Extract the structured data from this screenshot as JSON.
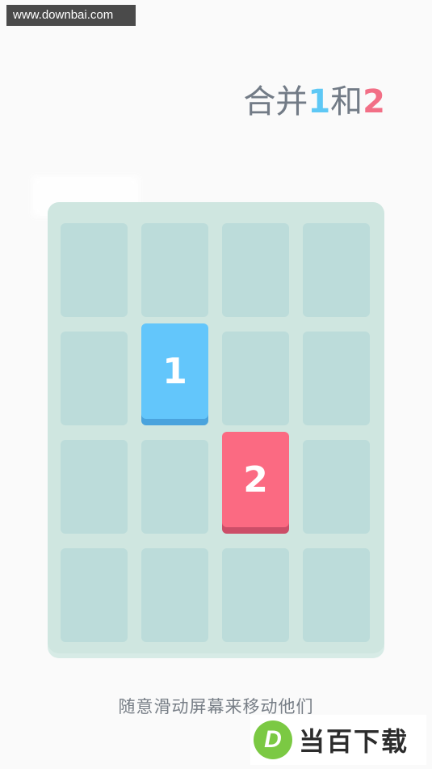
{
  "watermark_top": "www.downbai.com",
  "title": {
    "prefix": "合并",
    "num1": "1",
    "mid": "和",
    "num2": "2"
  },
  "board": {
    "rows": 4,
    "cols": 4,
    "tiles": [
      {
        "value": "1",
        "row": 1,
        "col": 1,
        "color": "blue"
      },
      {
        "value": "2",
        "row": 2,
        "col": 2,
        "color": "red"
      }
    ]
  },
  "colors": {
    "blue_tile": "#63c6fb",
    "red_tile": "#fb6a82",
    "board": "#cfe6e0",
    "cell": "#bcdcda",
    "title_text": "#727b86"
  },
  "instruction": "随意滑动屏幕来移动他们",
  "logo": {
    "mark": "D",
    "text": "当百下载"
  }
}
